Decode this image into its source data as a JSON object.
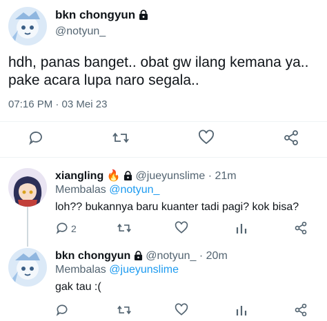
{
  "main_tweet": {
    "display_name": "bkn chongyun",
    "handle": "@notyun_",
    "text_line1": "hdh, panas banget.. obat gw ilang kemana ya..",
    "text_line2": "pake acara lupa naro segala..",
    "timestamp": "07:16 PM · 03 Mei 23"
  },
  "replies": [
    {
      "display_name": "xiangling",
      "emoji": "🔥",
      "handle": "@jueyunslime",
      "time": "· 21m",
      "replying_label": "Membalas",
      "replying_to": "@notyun_",
      "text": "loh?? bukannya baru kuanter tadi pagi? kok bisa?",
      "reply_count": "2"
    },
    {
      "display_name": "bkn chongyun",
      "handle": "@notyun_",
      "time": "· 20m",
      "replying_label": "Membalas",
      "replying_to": "@jueyunslime",
      "text": "gak tau :("
    }
  ],
  "icons": {
    "reply": "reply-bubble-icon",
    "retweet": "retweet-icon",
    "like": "heart-icon",
    "analytics": "analytics-icon",
    "share": "share-icon",
    "lock": "lock-icon"
  },
  "colors": {
    "accent": "#1d9bf0",
    "muted": "#536471",
    "text": "#0f1419"
  }
}
